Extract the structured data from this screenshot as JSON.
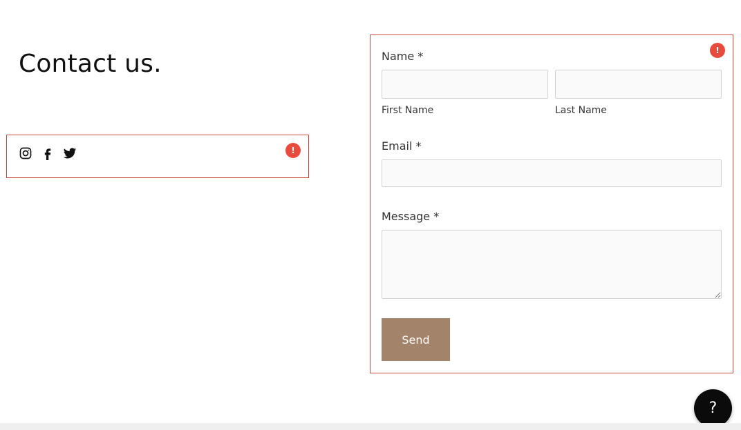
{
  "header": {
    "title": "Contact us."
  },
  "social": {
    "error_marker": "!",
    "icons": [
      {
        "name": "instagram-icon"
      },
      {
        "name": "facebook-icon"
      },
      {
        "name": "twitter-icon"
      }
    ]
  },
  "form": {
    "error_marker": "!",
    "name_label": "Name *",
    "first_name_sublabel": "First Name",
    "last_name_sublabel": "Last Name",
    "first_name_value": "",
    "last_name_value": "",
    "email_label": "Email *",
    "email_value": "",
    "message_label": "Message *",
    "message_value": "",
    "send_label": "Send"
  },
  "help": {
    "label": "?"
  },
  "colors": {
    "accent_button": "#a4836b",
    "error_border": "#c9463d",
    "error_badge": "#e84b3c"
  }
}
